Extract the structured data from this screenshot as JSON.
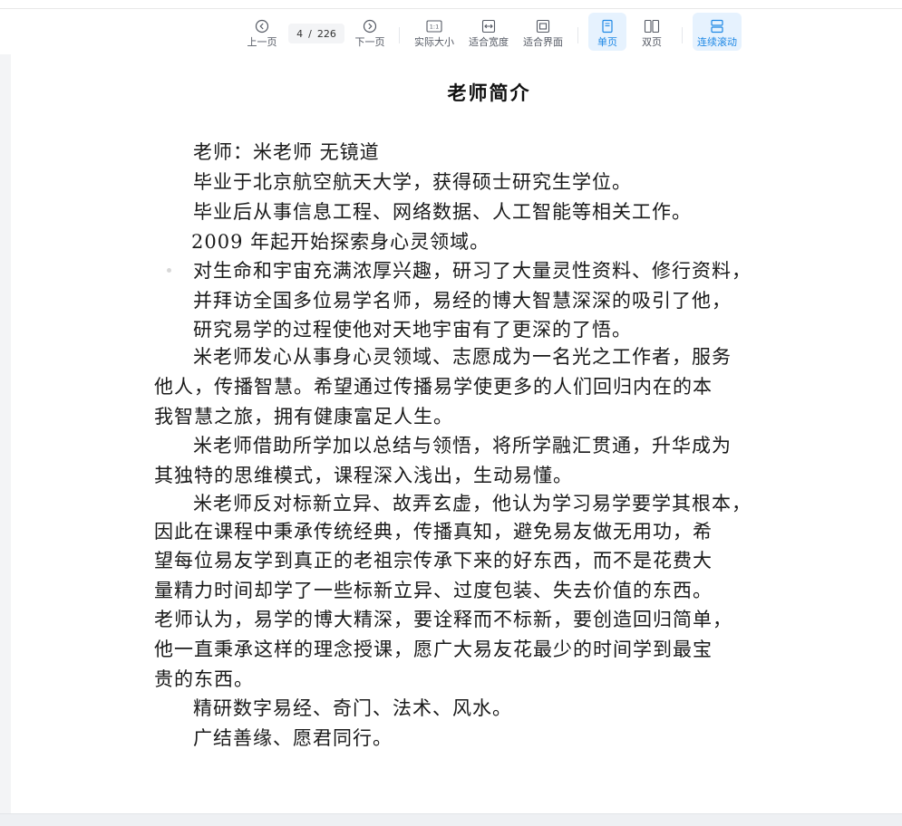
{
  "toolbar": {
    "prev_label": "上一页",
    "next_label": "下一页",
    "current_page": "4",
    "page_sep": "/",
    "total_pages": "226",
    "actual_size_label": "实际大小",
    "actual_size_icon_text": "1:1",
    "fit_width_label": "适合宽度",
    "fit_page_label": "适合界面",
    "single_page_label": "单页",
    "double_page_label": "双页",
    "continuous_label": "连续滚动",
    "accent_color": "#1e88e5"
  },
  "document": {
    "title": "老师简介",
    "lines": [
      "老师：米老师  无镜道",
      "毕业于北京航空航天大学，获得硕士研究生学位。",
      "毕业后从事信息工程、网络数据、人工智能等相关工作。",
      "2009 年起开始探索身心灵领域。",
      "对生命和宇宙充满浓厚兴趣，研习了大量灵性资料、修行资料，",
      "并拜访全国多位易学名师，易经的博大智慧深深的吸引了他，",
      "研究易学的过程使他对天地宇宙有了更深的了悟。",
      "米老师发心从事身心灵领域、志愿成为一名光之工作者，服务",
      "他人，传播智慧。希望通过传播易学使更多的人们回归内在的本",
      "我智慧之旅，拥有健康富足人生。",
      "米老师借助所学加以总结与领悟，将所学融汇贯通，升华成为",
      "其独特的思维模式，课程深入浅出，生动易懂。",
      "米老师反对标新立异、故弄玄虚，他认为学习易学要学其根本，",
      "因此在课程中秉承传统经典，传播真知，避免易友做无用功，希",
      "望每位易友学到真正的老祖宗传承下来的好东西，而不是花费大",
      "量精力时间却学了一些标新立异、过度包装、失去价值的东西。",
      "老师认为，易学的博大精深，要诠释而不标新，要创造回归简单，",
      "他一直秉承这样的理念授课，愿广大易友花最少的时间学到最宝",
      "贵的东西。",
      "精研数字易经、奇门、法术、风水。",
      "广结善缘、愿君同行。"
    ]
  }
}
